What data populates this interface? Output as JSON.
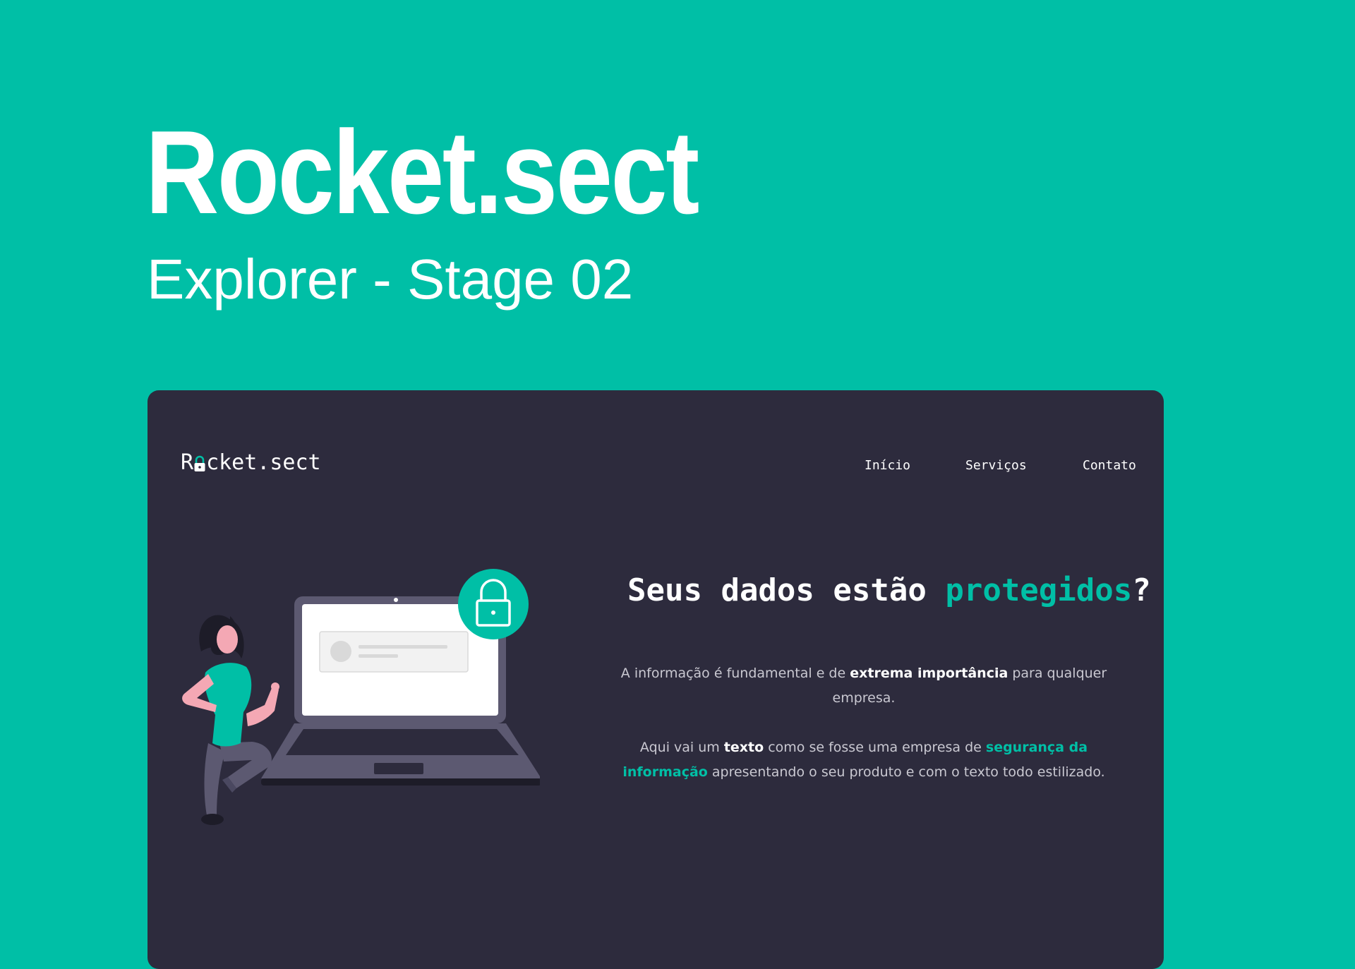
{
  "banner": {
    "title": "Rocket.sect",
    "subtitle": "Explorer - Stage 02"
  },
  "site": {
    "logo": {
      "before": "R",
      "after": "cket.sect",
      "icon": "padlock-icon"
    },
    "nav": [
      {
        "label": "Início"
      },
      {
        "label": "Serviços"
      },
      {
        "label": "Contato"
      }
    ],
    "hero": {
      "headline_part1": "Seus dados estão ",
      "headline_accent": "protegidos",
      "headline_part2": "?",
      "paragraph1": {
        "t1": "A informação é fundamental e de ",
        "b1": "extrema importância",
        "t2": " para qualquer empresa."
      },
      "paragraph2": {
        "t1": "Aqui vai um ",
        "b1": "texto",
        "t2": " como se fosse uma empresa de ",
        "accent": "segurança da informação",
        "t3": " apresentando o seu produto e com o texto todo estilizado."
      },
      "illustration": "woman-with-laptop-and-padlock-illustration"
    }
  },
  "colors": {
    "background": "#00BFA6",
    "card": "#2D2B3D",
    "accent": "#00BFA6",
    "text": "#FFFFFF",
    "muted_text": "#C9C8D1",
    "laptop": "#5C5971"
  }
}
